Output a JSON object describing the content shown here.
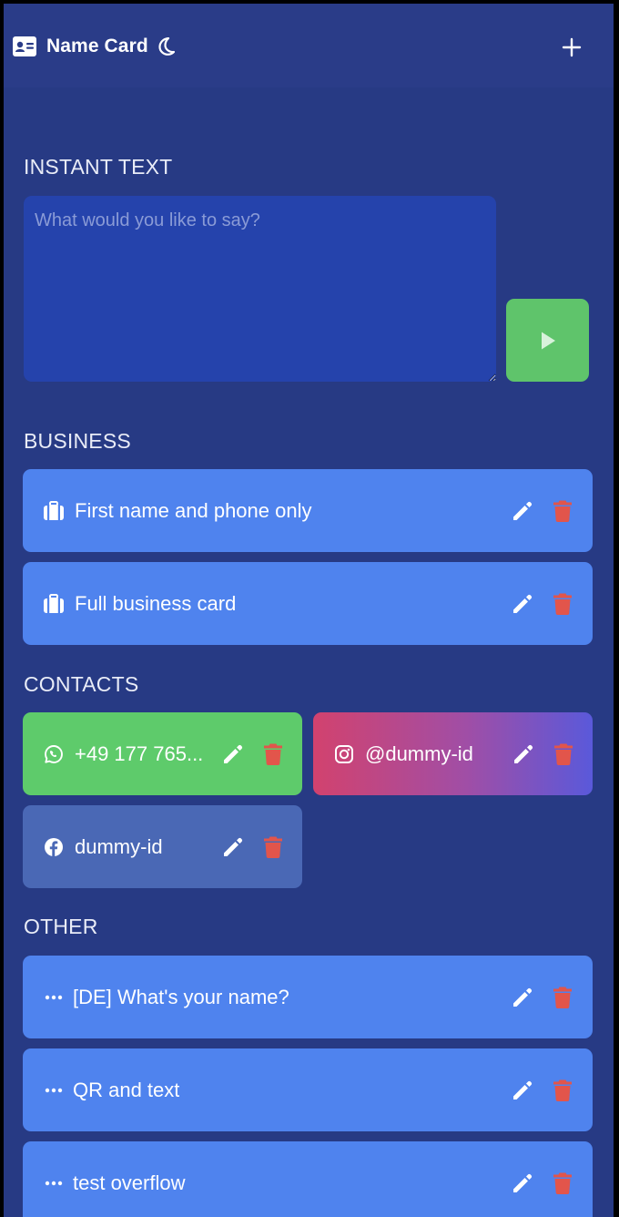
{
  "header": {
    "title": "Name Card"
  },
  "instant_text": {
    "section_title": "INSTANT TEXT",
    "placeholder": "What would you like to say?",
    "value": ""
  },
  "business": {
    "section_title": "BUSINESS",
    "items": [
      {
        "label": "First name and phone only",
        "icon": "briefcase-icon"
      },
      {
        "label": "Full business card",
        "icon": "briefcase-icon"
      }
    ]
  },
  "contacts": {
    "section_title": "CONTACTS",
    "items": [
      {
        "label": "+49 177 765...",
        "icon": "whatsapp-icon",
        "color": "#5ecb6b"
      },
      {
        "label": "@dummy-id",
        "icon": "instagram-icon",
        "color": "#d2426e"
      },
      {
        "label": "dummy-id",
        "icon": "facebook-icon",
        "color": "#4a68b5"
      }
    ]
  },
  "other": {
    "section_title": "OTHER",
    "items": [
      {
        "label": "[DE] What's your name?",
        "icon": "ellipsis-icon"
      },
      {
        "label": "QR and text",
        "icon": "ellipsis-icon"
      },
      {
        "label": "test overflow",
        "icon": "ellipsis-icon"
      }
    ]
  },
  "colors": {
    "background": "#273a84",
    "card": "#4f83ee",
    "send_button": "#5fc46b",
    "delete_icon": "#e2554b",
    "input_background": "#2543ac"
  }
}
